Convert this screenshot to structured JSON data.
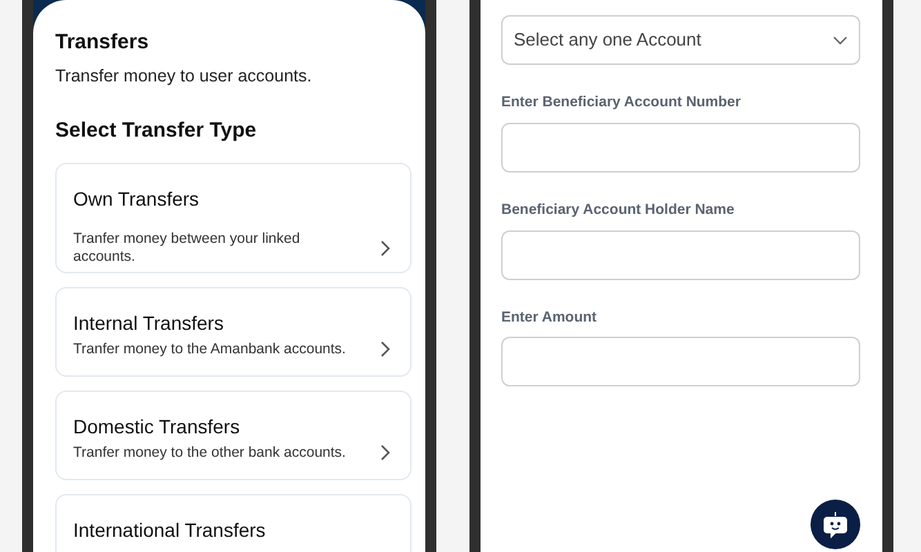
{
  "transfers_screen": {
    "title": "Transfers",
    "subtitle": "Transfer money to user accounts.",
    "section_title": "Select Transfer Type",
    "options": [
      {
        "title": "Own Transfers",
        "description": "Tranfer money between your linked accounts."
      },
      {
        "title": "Internal Transfers",
        "description": "Tranfer money to the Amanbank accounts."
      },
      {
        "title": "Domestic Transfers",
        "description": "Tranfer money to the other bank accounts."
      },
      {
        "title": "International Transfers"
      }
    ]
  },
  "form_screen": {
    "fields": [
      {
        "kind": "select",
        "placeholder": "Select any one Account"
      },
      {
        "kind": "text",
        "label": "Enter Beneficiary Account Number"
      },
      {
        "kind": "text",
        "label": "Beneficiary Account Holder Name"
      },
      {
        "kind": "text",
        "label": "Enter Amount"
      }
    ]
  }
}
